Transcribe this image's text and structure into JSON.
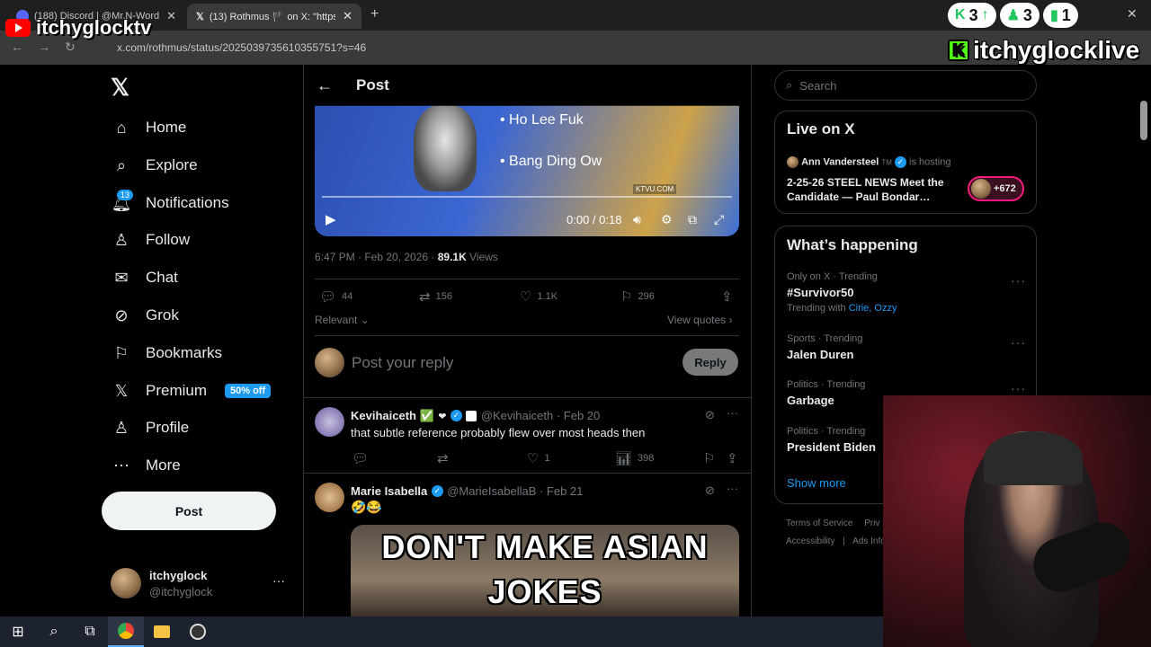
{
  "browser": {
    "tabs": [
      {
        "title": "(188) Discord | @Mr.N-Word",
        "active": false
      },
      {
        "title": "(13) Rothmus 🏴 on X: \"https://",
        "active": true
      }
    ],
    "url": "x.com/rothmus/status/2025039735610355751?s=46"
  },
  "overlay": {
    "youtube_handle": "itchyglocktv",
    "kick_handle": "itchyglocklive",
    "stats": [
      {
        "icon": "kick-icon",
        "value": "3",
        "arrow": "up-arrow"
      },
      {
        "icon": "person-icon",
        "value": "3"
      },
      {
        "icon": "chart-icon",
        "value": "1"
      }
    ]
  },
  "sidebar": {
    "items": [
      {
        "label": "Home",
        "icon": "home-icon"
      },
      {
        "label": "Explore",
        "icon": "search-icon"
      },
      {
        "label": "Notifications",
        "icon": "bell-icon",
        "badge": "13"
      },
      {
        "label": "Follow",
        "icon": "add-person-icon"
      },
      {
        "label": "Chat",
        "icon": "mail-icon"
      },
      {
        "label": "Grok",
        "icon": "grok-icon"
      },
      {
        "label": "Bookmarks",
        "icon": "bookmark-icon"
      },
      {
        "label": "Premium",
        "icon": "x-logo-icon",
        "tag": "50% off"
      },
      {
        "label": "Profile",
        "icon": "person-icon"
      },
      {
        "label": "More",
        "icon": "more-circle-icon"
      }
    ],
    "post_label": "Post",
    "account": {
      "name": "itchyglock",
      "handle": "@itchyglock"
    }
  },
  "post": {
    "header_title": "Post",
    "video": {
      "line1": "• Ho Lee Fuk",
      "line2": "• Bang Ding Ow",
      "watermark": "KTVU.COM",
      "time": "0:00 / 0:18"
    },
    "timestamp": "6:47 PM · Feb 20, 2026 · ",
    "views_count": "89.1K",
    "views_label": " Views",
    "actions": {
      "replies": "44",
      "reposts": "156",
      "likes": "1.1K",
      "bookmarks": "296"
    },
    "sort_label": "Relevant",
    "view_quotes": "View quotes",
    "reply_placeholder": "Post your reply",
    "reply_button": "Reply"
  },
  "replies": [
    {
      "name": "Kevihaiceth ✅",
      "handle": "@Kevihaiceth · Feb 20",
      "text": "that subtle reference probably flew over most heads then",
      "likes": "1",
      "views": "398"
    },
    {
      "name": "Marie Isabella",
      "handle": "@MarieIsabellaB · Feb 21",
      "text": "🤣😂",
      "meme_line1": "DON'T MAKE ASIAN",
      "meme_line2": "JOKES"
    }
  ],
  "right": {
    "search_placeholder": "Search",
    "live": {
      "title": "Live on X",
      "host_name": "Ann Vandersteel",
      "host_suffix": "TM",
      "host_status": "is hosting",
      "stream_title": "2-25-26 STEEL NEWS    Meet the Candidate — Paul Bondar…",
      "listeners": "+672"
    },
    "happening": {
      "title": "What’s happening",
      "trends": [
        {
          "category": "Only on X · Trending",
          "name": "#Survivor50",
          "with_label": "Trending with",
          "with_names": "Cirie, Ozzy"
        },
        {
          "category": "Sports · Trending",
          "name": "Jalen Duren"
        },
        {
          "category": "Politics · Trending",
          "name": "Garbage"
        },
        {
          "category": "Politics · Trending",
          "name": "President Biden"
        }
      ],
      "show_more": "Show more"
    },
    "footer": {
      "terms": "Terms of Service",
      "privacy": "Priv",
      "accessibility": "Accessibility",
      "ads": "Ads Info"
    }
  },
  "colors": {
    "accent": "#1d9bf0",
    "kick_green": "#53fc18",
    "youtube_red": "#ff0000"
  }
}
